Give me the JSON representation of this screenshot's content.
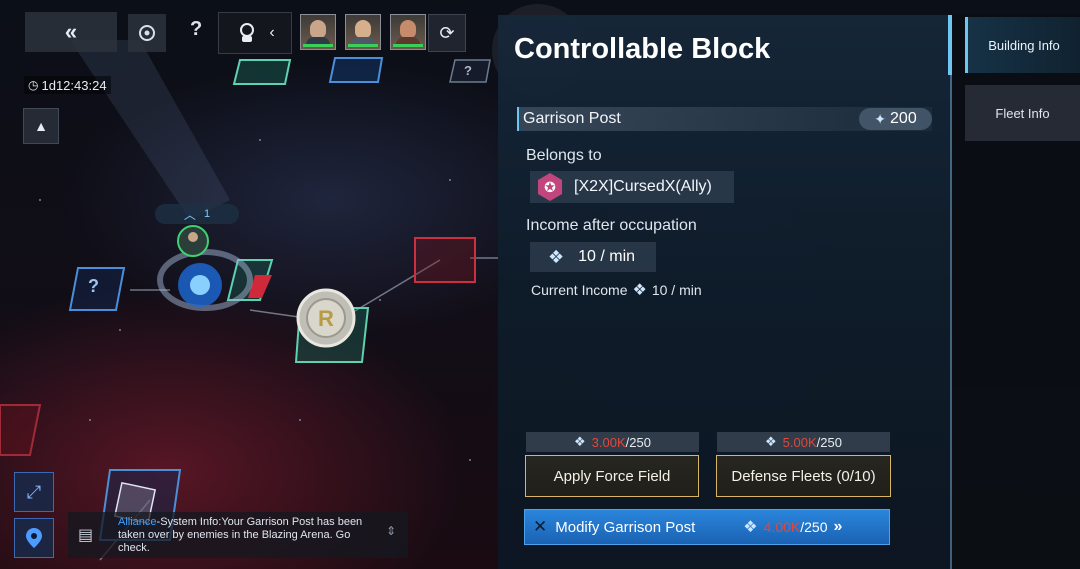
{
  "hud": {
    "timer": "1d12:43:24",
    "help_label": "?",
    "map_question_a": "?",
    "map_question_b": "?",
    "node_level": "1"
  },
  "panel": {
    "title": "Controllable Block",
    "building_name": "Garrison Post",
    "building_value": "200",
    "belongs_label": "Belongs to",
    "owner": "[X2X]CursedX(Ally)",
    "income_label": "Income after occupation",
    "income_value": "10 / min",
    "current_income_label": "Current Income",
    "current_income_value": "10 / min"
  },
  "actions": {
    "force_field": {
      "cost_have": "3.00K",
      "cost_need": "/250",
      "label": "Apply Force Field"
    },
    "defense": {
      "cost_have": "5.00K",
      "cost_need": "/250",
      "label": "Defense Fleets (0/10)"
    },
    "modify": {
      "label": "Modify Garrison Post",
      "cost_have": "4.00K",
      "cost_need": "/250"
    }
  },
  "tabs": {
    "building_info": "Building Info",
    "fleet_info": "Fleet Info"
  },
  "chat": {
    "channel": "Alliance",
    "message": "-System Info:Your Garrison Post has been taken over by enemies in the Blazing Arena. Go check."
  },
  "colors": {
    "accent_blue": "#1f73c9",
    "gold_border": "#d7b563",
    "cost_red": "#e0483d",
    "tab_active": "#6fc6f0"
  }
}
